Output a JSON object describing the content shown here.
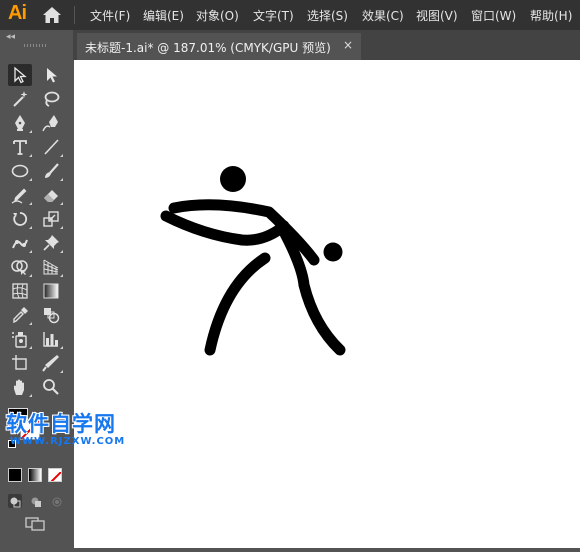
{
  "app": {
    "logo": "Ai",
    "brand_color": "#ff9a00"
  },
  "menu": {
    "items": [
      {
        "label": "文件(F)"
      },
      {
        "label": "编辑(E)"
      },
      {
        "label": "对象(O)"
      },
      {
        "label": "文字(T)"
      },
      {
        "label": "选择(S)"
      },
      {
        "label": "效果(C)"
      },
      {
        "label": "视图(V)"
      },
      {
        "label": "窗口(W)"
      },
      {
        "label": "帮助(H)"
      }
    ]
  },
  "document_tab": {
    "title": "未标题-1.ai* @ 187.01% (CMYK/GPU 预览)",
    "close": "×"
  },
  "tools_panel": {
    "collapse": "◂◂",
    "tools": [
      "selection-tool",
      "direct-selection-tool",
      "magic-wand-tool",
      "lasso-tool",
      "pen-tool",
      "curvature-tool",
      "type-tool",
      "line-segment-tool",
      "ellipse-tool",
      "paintbrush-tool",
      "shaper-tool",
      "eraser-tool",
      "rotate-tool",
      "scale-tool",
      "puppet-warp-tool",
      "pin-tool",
      "shape-builder-tool",
      "perspective-grid-tool",
      "mesh-tool",
      "gradient-tool",
      "eyedropper-tool",
      "blend-tool",
      "symbol-sprayer-tool",
      "column-graph-tool",
      "artboard-tool",
      "slice-tool",
      "hand-tool",
      "zoom-tool"
    ],
    "fill_color": "#000000",
    "stroke": "none"
  },
  "watermark": {
    "title": "软件自学网",
    "url": "WWW.RJZXW.COM",
    "color": "#1677ee"
  }
}
